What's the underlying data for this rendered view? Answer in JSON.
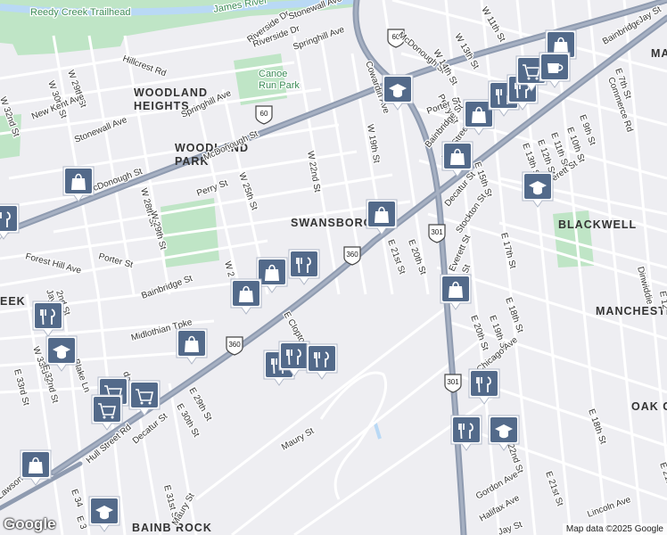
{
  "map": {
    "attribution": "Map data ©2025 Google",
    "logo": "Google",
    "colors": {
      "background": "#eeeef2",
      "park": "#bfe5c6",
      "river": "#b9d9f5",
      "highway": "#8f9bb0",
      "road": "#ffffff"
    },
    "neighborhoods": [
      "WOODLAND",
      "HEIGHTS",
      "WOODLAND",
      "PARK",
      "SWANSBORO",
      "BLACKWELL",
      "MANCHESTER",
      "OAK GROV",
      "BAINB ROCK",
      "EEK",
      "MAN"
    ],
    "parks": [
      "Reedy Creek Trailhead",
      "Canoe",
      "Run Park"
    ],
    "water": [
      "James River"
    ],
    "route_shields": [
      "60",
      "60",
      "360",
      "360",
      "301",
      "301"
    ],
    "streets": [
      "Riverside Dr",
      "Stonewall Ave",
      "Springhill Ave",
      "Riverside Dr",
      "Hillcrest Rd",
      "W 29th St",
      "W 30th St",
      "W 32nd St",
      "New Kent Ave",
      "Stonewall Ave",
      "Springhill Ave",
      "McDonough St",
      "W 22nd St",
      "W 25th St",
      "Perry St",
      "McDonough St",
      "W 28th St",
      "W 29th St",
      "Porter St",
      "Bainbridge St",
      "Forest Hill Ave",
      "W 2",
      "Midlothian Tpke",
      "E Clopton",
      "W 33rd St",
      "Blake Ln",
      "E 33rd St",
      "E 32nd St",
      "E 29th St",
      "E 30th St",
      "Decatur St",
      "Hull Street Rd",
      "Maury St",
      "E 31st St",
      "Maury St",
      "E 34",
      "Cowardin Ave",
      "W 19th St",
      "McDonough St",
      "W 13th St",
      "W 14th St",
      "W 11th St",
      "Perry St",
      "Porter St",
      "Bainbridge St",
      "Hull Street Rd",
      "E 9th St",
      "E 10th St",
      "E 11th St",
      "E 12th St",
      "E 13th St",
      "E 15th St",
      "E 7th St",
      "Commerce Rd",
      "Bainbridge",
      "Everett St",
      "Decatur St",
      "Stockton St",
      "E 17th St",
      "E 20th St",
      "E 21st St",
      "Everett St",
      "Perry St",
      "E 19th St",
      "E 20th St",
      "E 18th St",
      "Chicago Ave",
      "Dinwiddie",
      "E 12",
      "Gordon Ave",
      "Halifax Ave",
      "E 22nd St",
      "E 21st St",
      "E 18th St",
      "E 21st St",
      "Lincoln Ave",
      "Jay St",
      "Lawson St",
      "E 3",
      "don St",
      "Jay St",
      "2nd St",
      "Jay St"
    ]
  },
  "pois": [
    {
      "type": "shopping"
    },
    {
      "type": "shopping"
    },
    {
      "type": "shopping"
    },
    {
      "type": "shopping"
    },
    {
      "type": "shopping"
    },
    {
      "type": "shopping"
    },
    {
      "type": "shopping"
    },
    {
      "type": "shopping"
    },
    {
      "type": "shopping"
    },
    {
      "type": "shopping"
    },
    {
      "type": "shopping"
    },
    {
      "type": "restaurant"
    },
    {
      "type": "restaurant"
    },
    {
      "type": "restaurant"
    },
    {
      "type": "restaurant"
    },
    {
      "type": "restaurant"
    },
    {
      "type": "restaurant"
    },
    {
      "type": "restaurant"
    },
    {
      "type": "restaurant"
    },
    {
      "type": "restaurant"
    },
    {
      "type": "restaurant"
    },
    {
      "type": "school"
    },
    {
      "type": "school"
    },
    {
      "type": "school"
    },
    {
      "type": "school"
    },
    {
      "type": "school"
    },
    {
      "type": "grocery"
    },
    {
      "type": "grocery"
    },
    {
      "type": "grocery"
    },
    {
      "type": "grocery"
    },
    {
      "type": "cafe"
    }
  ]
}
